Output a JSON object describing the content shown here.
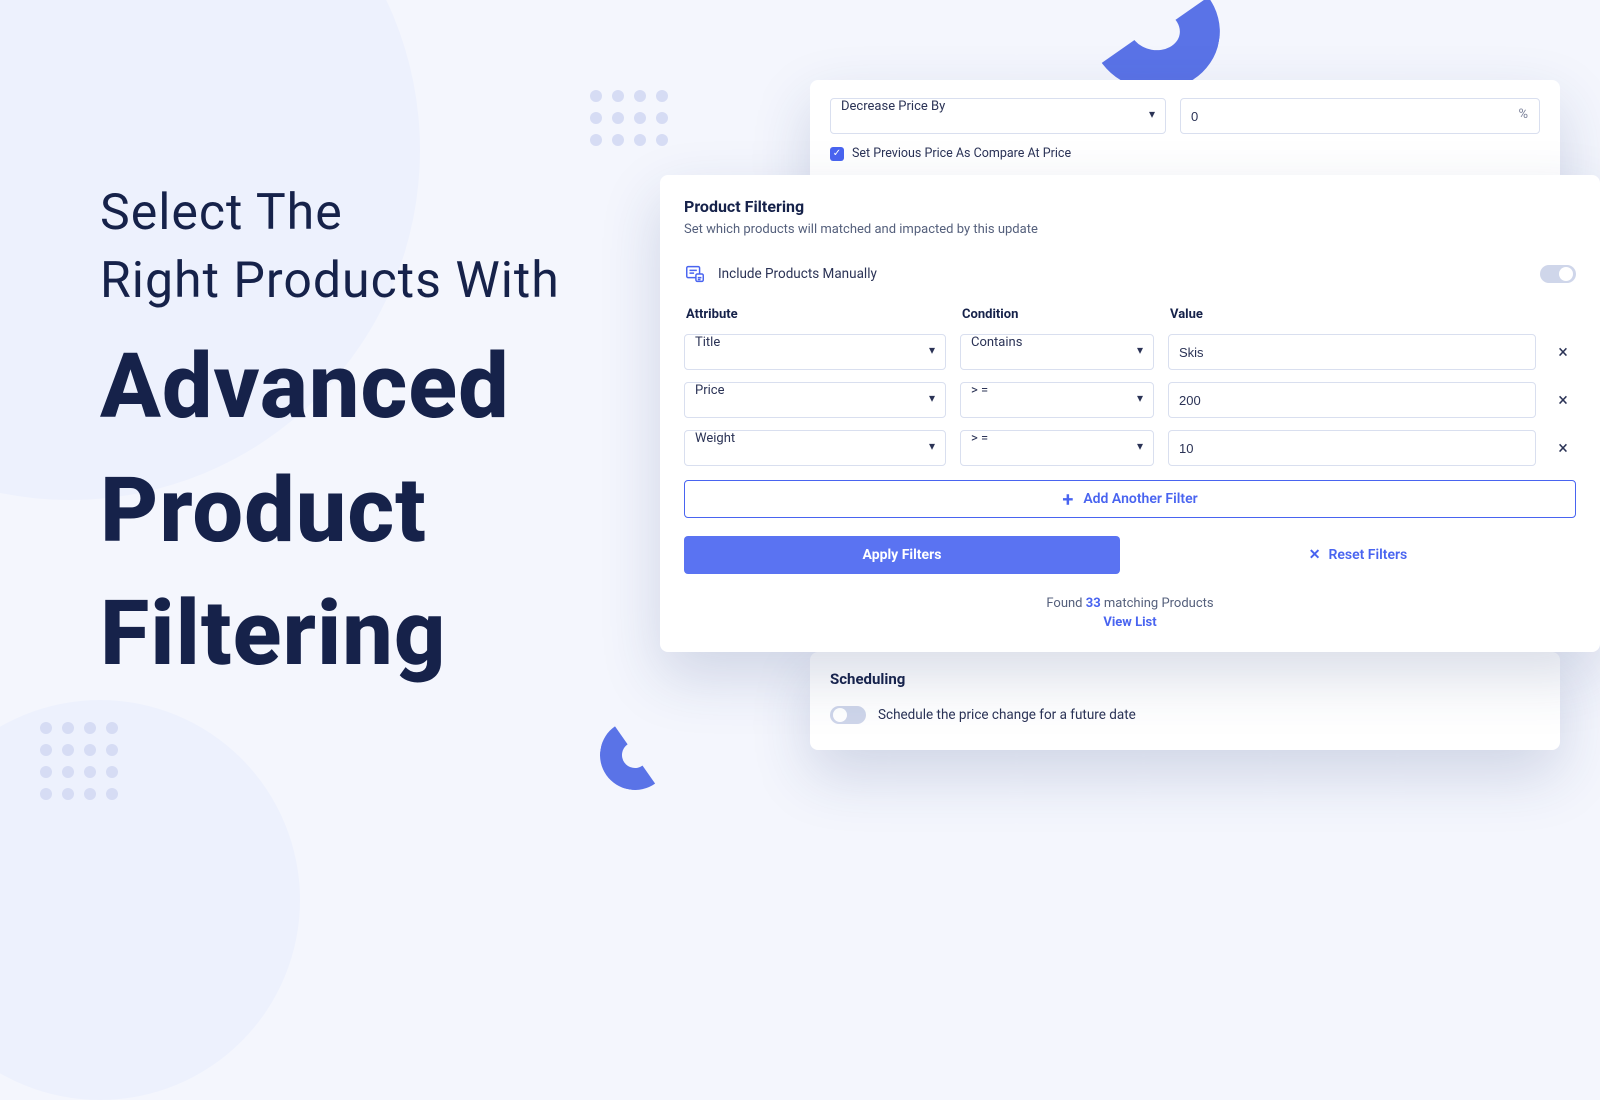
{
  "headline": {
    "line1": "Select The",
    "line2": "Right Products With",
    "bold1": "Advanced",
    "bold2": "Product",
    "bold3": "Filtering"
  },
  "priceBox": {
    "action": "Decrease Price By",
    "amount": "0",
    "suffix": "%",
    "compareChecked": true,
    "compareLabel": "Set Previous Price As Compare At Price"
  },
  "filtering": {
    "title": "Product Filtering",
    "subtitle": "Set which products will matched and impacted by this update",
    "manualLabel": "Include Products Manually",
    "manualOn": false,
    "headers": {
      "attribute": "Attribute",
      "condition": "Condition",
      "value": "Value"
    },
    "rows": [
      {
        "attribute": "Title",
        "condition": "Contains",
        "value": "Skis"
      },
      {
        "attribute": "Price",
        "condition": "> =",
        "value": "200"
      },
      {
        "attribute": "Weight",
        "condition": "> =",
        "value": "10"
      }
    ],
    "addLabel": "Add Another Filter",
    "applyLabel": "Apply Filters",
    "resetLabel": "Reset Filters",
    "foundPrefix": "Found ",
    "foundCount": "33",
    "foundSuffix": " matching Products",
    "viewList": "View List"
  },
  "scheduling": {
    "title": "Scheduling",
    "label": "Schedule the price change for a future date",
    "on": false
  }
}
